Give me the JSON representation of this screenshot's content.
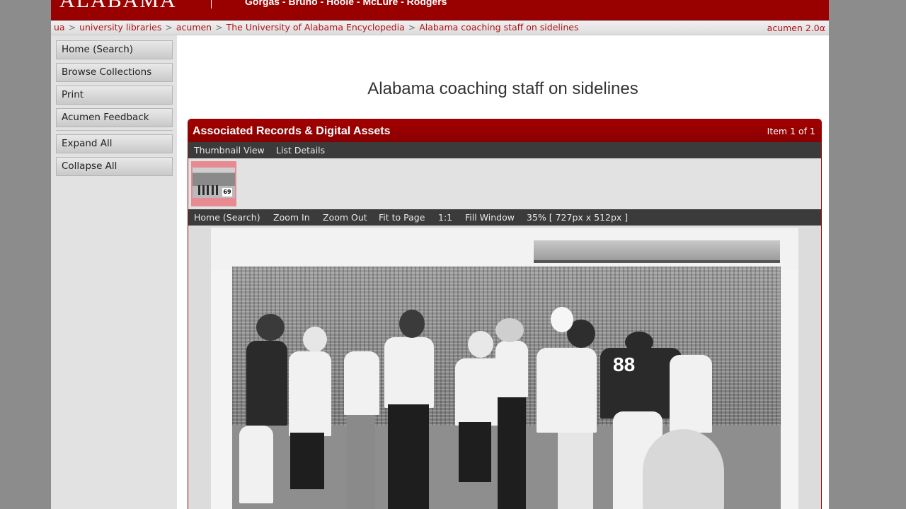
{
  "banner": {
    "logo_text": "ALABAMA",
    "halls_text": "Gorgas - Bruno - Hoole - McLure - Rodgers"
  },
  "breadcrumb": {
    "items": [
      "ua",
      "university libraries",
      "acumen",
      "The University of Alabama Encyclopedia",
      "Alabama coaching staff on sidelines"
    ],
    "separator": ">",
    "version": "acumen 2.0α"
  },
  "sidebar": {
    "items": [
      "Home (Search)",
      "Browse Collections",
      "Print",
      "Acumen Feedback",
      "Expand All",
      "Collapse All"
    ]
  },
  "main": {
    "title": "Alabama coaching staff on sidelines",
    "panel": {
      "title": "Associated Records & Digital Assets",
      "count": "Item 1 of 1",
      "tabs": [
        "Thumbnail View",
        "List Details"
      ],
      "thumbnail_number": "69",
      "viewer_controls": [
        "Home (Search)",
        "Zoom In",
        "Zoom Out",
        "Fit to Page",
        "1:1",
        "Fill Window"
      ],
      "zoom_status": "35% [ 727px x 512px ]",
      "photo_jersey_number": "88"
    }
  },
  "colors": {
    "brand_red": "#990000",
    "link_red": "#b3141b",
    "toolbar_dark": "#3b3b3b"
  }
}
